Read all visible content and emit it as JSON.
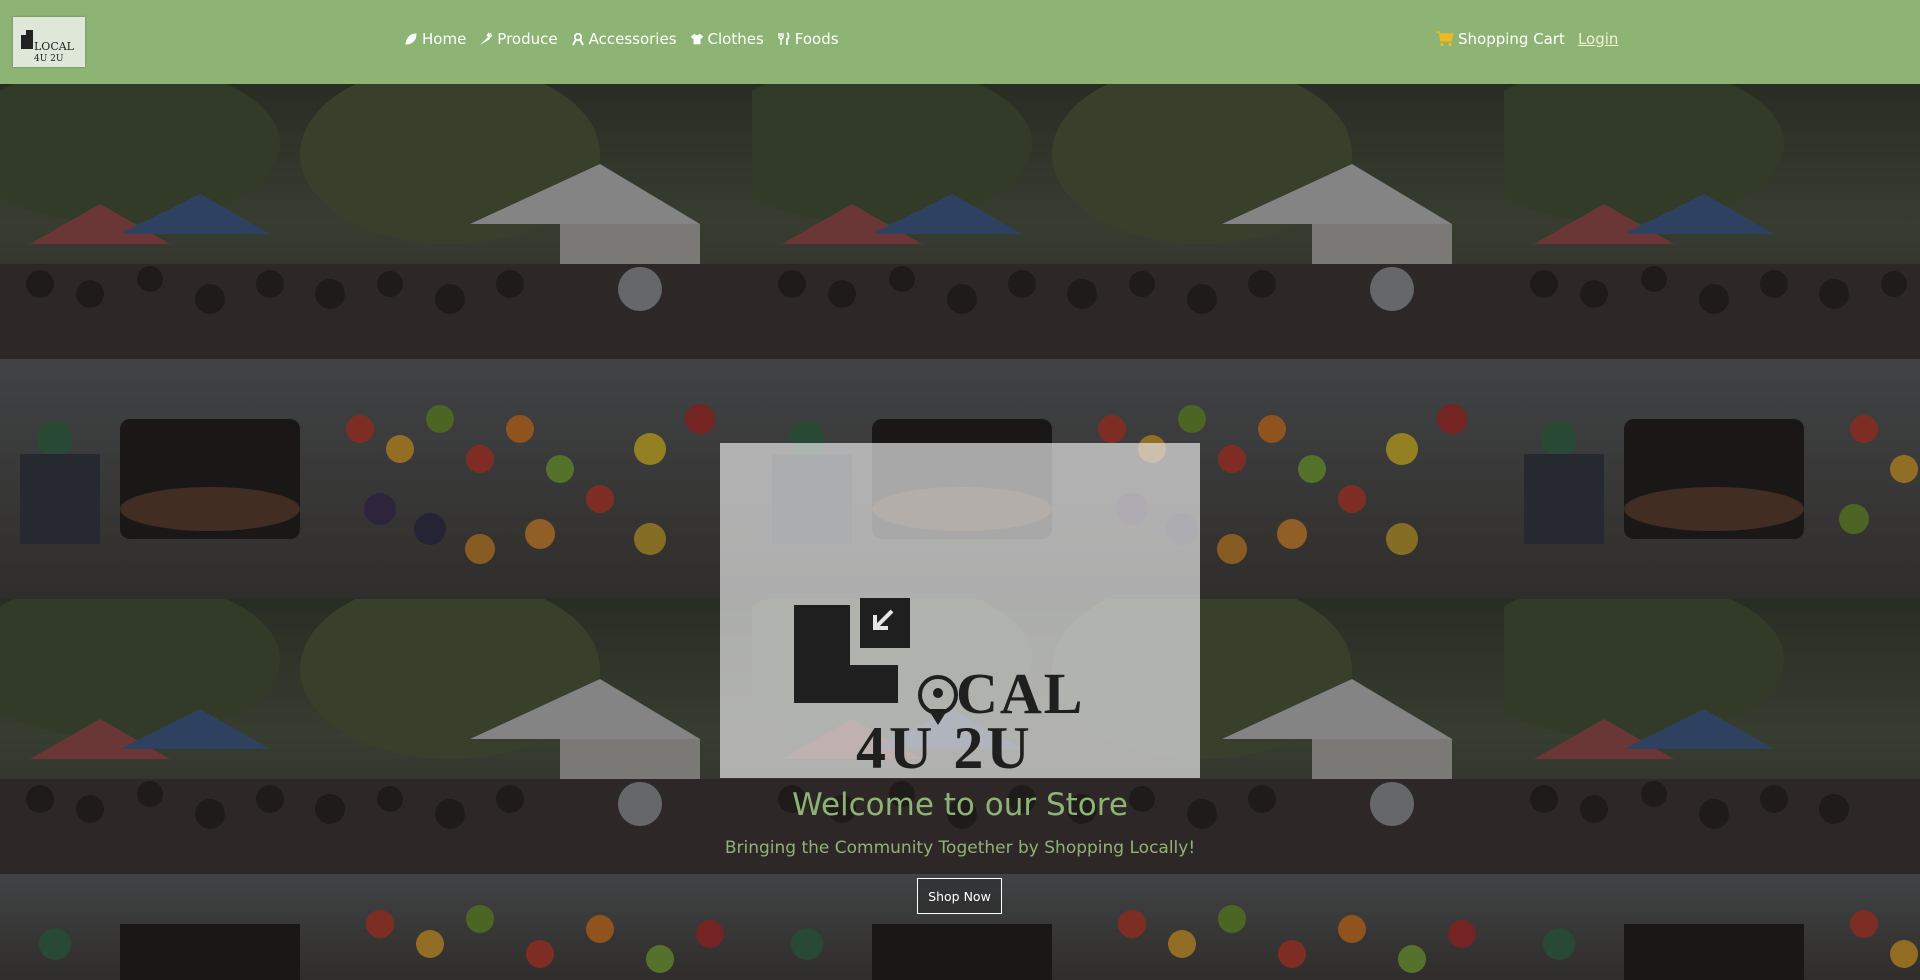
{
  "brand": {
    "logo_text_line1": "LOCAL",
    "logo_text_line2": "4U 2U"
  },
  "nav": {
    "links": [
      {
        "label": "Home",
        "icon": "leaf-icon"
      },
      {
        "label": "Produce",
        "icon": "carrot-icon"
      },
      {
        "label": "Accessories",
        "icon": "ribbon-icon"
      },
      {
        "label": "Clothes",
        "icon": "shirt-icon"
      },
      {
        "label": "Foods",
        "icon": "utensils-icon"
      }
    ],
    "cart_label": "Shopping Cart",
    "cart_icon": "shopping-cart-icon",
    "login_label": "Login"
  },
  "hero": {
    "title": "Welcome to our Store",
    "subtitle": "Bringing the Community Together by Shopping Locally!",
    "button_label": "Shop Now"
  },
  "colors": {
    "brand_green": "#8db475",
    "nav_text": "#ffffff",
    "login_text": "#f3f0d6"
  }
}
